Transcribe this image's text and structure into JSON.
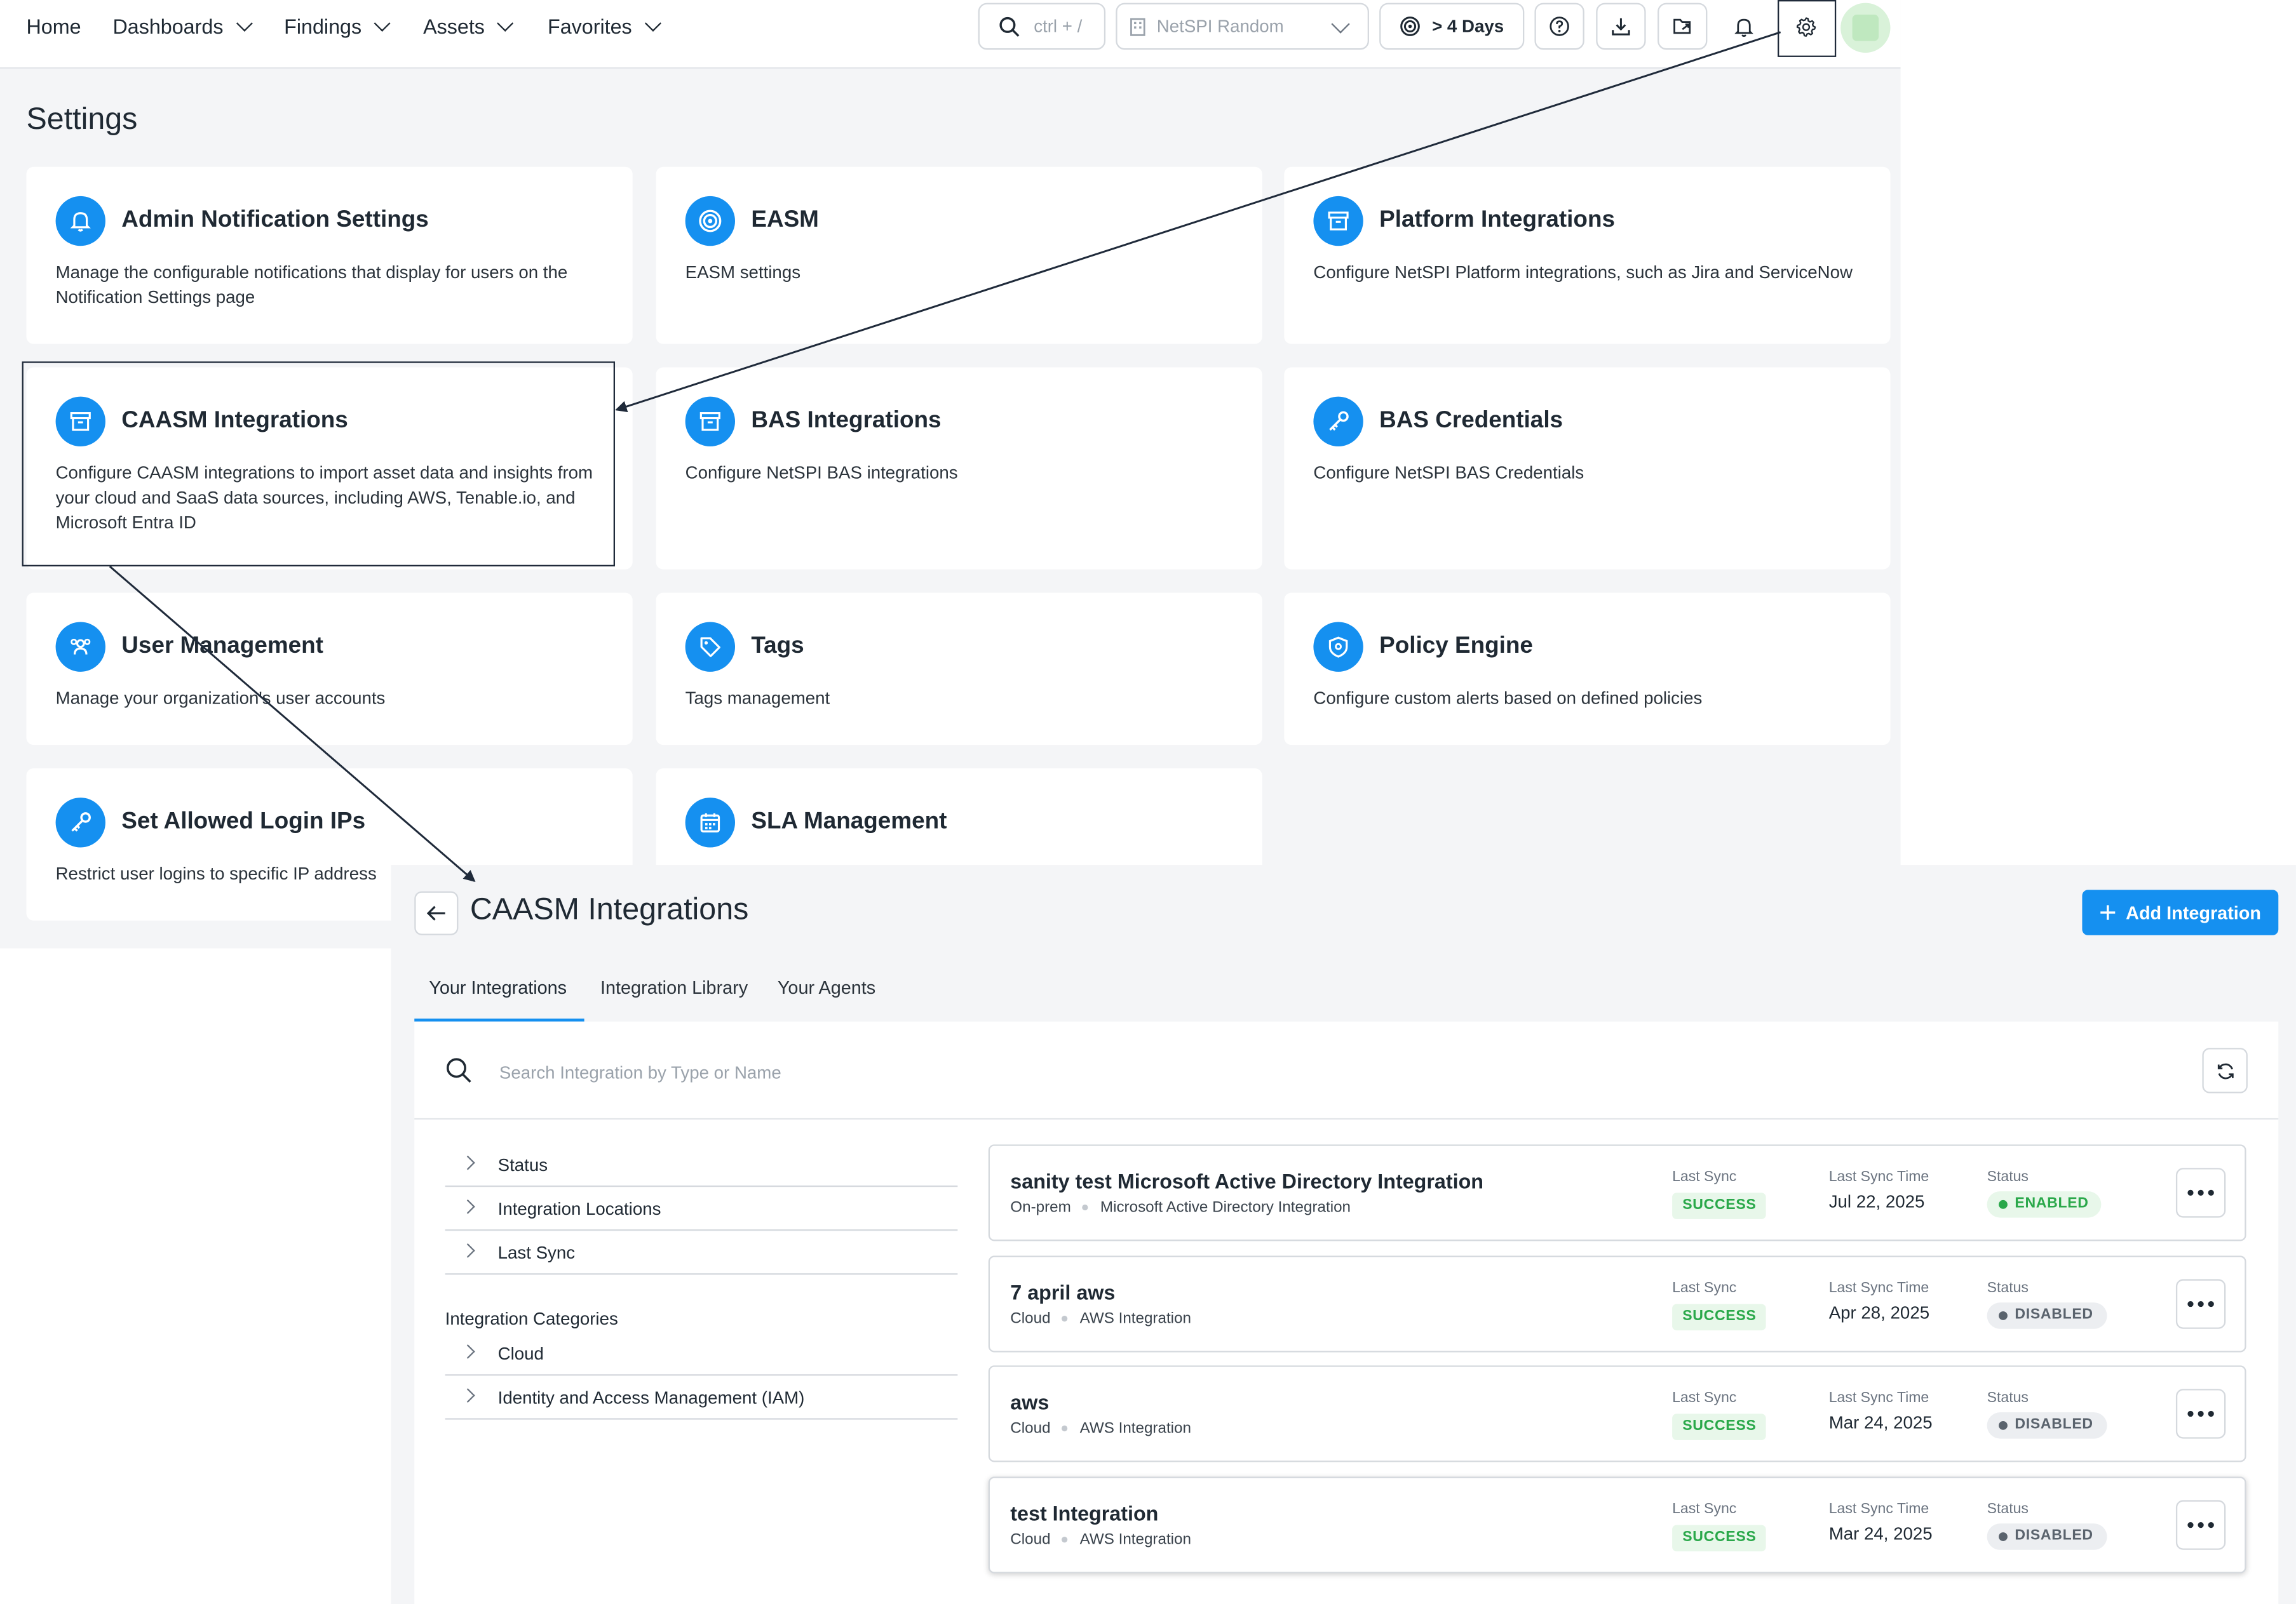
{
  "topnav": {
    "items": [
      {
        "label": "Home",
        "has_dropdown": false
      },
      {
        "label": "Dashboards",
        "has_dropdown": true
      },
      {
        "label": "Findings",
        "has_dropdown": true
      },
      {
        "label": "Assets",
        "has_dropdown": true
      },
      {
        "label": "Favorites",
        "has_dropdown": true
      }
    ],
    "search_shortcut": "ctrl + /",
    "org_select": "NetSPI Random",
    "days_filter": "> 4 Days",
    "icons": [
      "help-icon",
      "download-icon",
      "export-icon",
      "bell-icon",
      "gear-icon",
      "avatar"
    ]
  },
  "settings": {
    "title": "Settings",
    "cards": [
      {
        "title": "Admin Notification Settings",
        "description": "Manage the configurable notifications that display for users on the Notification Settings page",
        "icon": "bell-icon"
      },
      {
        "title": "EASM",
        "description": "EASM settings",
        "icon": "target-icon"
      },
      {
        "title": "Platform Integrations",
        "description": "Configure NetSPI Platform integrations, such as Jira and ServiceNow",
        "icon": "archive-icon"
      },
      {
        "title": "CAASM Integrations",
        "description": "Configure CAASM integrations to import asset data and insights from your cloud and SaaS data sources, including AWS, Tenable.io, and Microsoft Entra ID",
        "icon": "archive-icon"
      },
      {
        "title": "BAS Integrations",
        "description": "Configure NetSPI BAS integrations",
        "icon": "archive-icon"
      },
      {
        "title": "BAS Credentials",
        "description": "Configure NetSPI BAS Credentials",
        "icon": "key-icon"
      },
      {
        "title": "User Management",
        "description": "Manage your organization's user accounts",
        "icon": "users-icon"
      },
      {
        "title": "Tags",
        "description": "Tags management",
        "icon": "tag-icon"
      },
      {
        "title": "Policy Engine",
        "description": "Configure custom alerts based on defined policies",
        "icon": "shield-icon"
      },
      {
        "title": "Set Allowed Login IPs",
        "description": "Restrict user logins to specific IP address",
        "icon": "key-icon"
      },
      {
        "title": "SLA Management",
        "description": "",
        "icon": "calendar-icon"
      }
    ]
  },
  "caasm": {
    "title": "CAASM Integrations",
    "add_button": "Add Integration",
    "tabs": [
      "Your Integrations",
      "Integration Library",
      "Your Agents"
    ],
    "active_tab": "Your Integrations",
    "search_placeholder": "Search Integration by Type or Name",
    "filters": [
      "Status",
      "Integration Locations",
      "Last Sync"
    ],
    "categories_heading": "Integration Categories",
    "categories": [
      "Cloud",
      "Identity and Access Management (IAM)"
    ],
    "column_labels": {
      "last_sync": "Last Sync",
      "last_sync_time": "Last Sync Time",
      "status": "Status"
    },
    "integrations": [
      {
        "name": "sanity test Microsoft Active Directory Integration",
        "location": "On-prem",
        "type": "Microsoft Active Directory Integration",
        "last_sync": "SUCCESS",
        "last_sync_time": "Jul 22, 2025",
        "status": "ENABLED"
      },
      {
        "name": "7 april aws",
        "location": "Cloud",
        "type": "AWS Integration",
        "last_sync": "SUCCESS",
        "last_sync_time": "Apr 28, 2025",
        "status": "DISABLED"
      },
      {
        "name": "aws",
        "location": "Cloud",
        "type": "AWS Integration",
        "last_sync": "SUCCESS",
        "last_sync_time": "Mar 24, 2025",
        "status": "DISABLED"
      },
      {
        "name": "test Integration",
        "location": "Cloud",
        "type": "AWS Integration",
        "last_sync": "SUCCESS",
        "last_sync_time": "Mar 24, 2025",
        "status": "DISABLED"
      }
    ]
  },
  "colors": {
    "accent": "#1590f0",
    "success": "#2aa84a",
    "callout": "#1f2a3a"
  }
}
